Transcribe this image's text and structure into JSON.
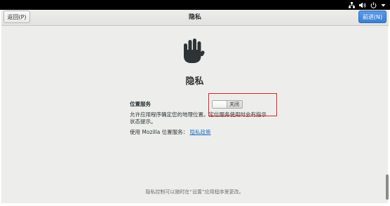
{
  "header": {
    "back_label": "返回(P)",
    "title": "隐私",
    "next_label": "前进(N)"
  },
  "status_bar": {
    "icons": [
      "network-icon",
      "volume-icon",
      "power-icon",
      "chevron-down-icon"
    ]
  },
  "main": {
    "heading": "隐私",
    "location": {
      "label": "位置服务",
      "description": "允许应用程序确定您的地理位置。定位服务使用时会有指示状态提示。",
      "toggle_label": "关闭",
      "toggle_state": "off"
    },
    "policy": {
      "prefix": "使用 Mozilla 位置服务：",
      "link_label": "隐私政策"
    },
    "footer": "隐私控制可以随时在“设置”应用程序里更改。"
  },
  "colors": {
    "accent": "#3a7fd1",
    "highlight": "#d9262b",
    "background": "#ededeb",
    "link": "#2a76c6"
  }
}
